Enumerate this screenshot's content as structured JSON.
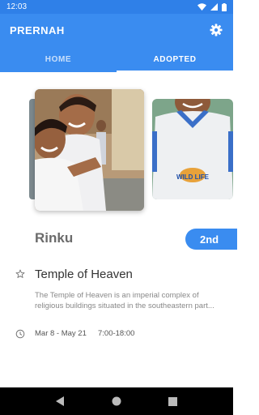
{
  "status_bar": {
    "time": "12:03",
    "icons": [
      "wifi-icon",
      "signal-icon",
      "battery-icon"
    ]
  },
  "app_bar": {
    "title": "PRERNAH",
    "settings_icon": "gear-icon"
  },
  "tabs": [
    {
      "label": "HOME",
      "active": false
    },
    {
      "label": "ADOPTED",
      "active": true
    }
  ],
  "carousel": {
    "images": [
      "children-photo",
      "child-shirt-photo"
    ],
    "shirt_logo_text": "WILD LIFE"
  },
  "profile": {
    "name": "Rinku",
    "rank_label": "2nd"
  },
  "place": {
    "icon": "star-outline-icon",
    "title": "Temple of Heaven",
    "description": "The Temple of Heaven is an imperial complex of religious buildings situated in the southeastern part...",
    "date_icon": "clock-icon",
    "dates": "Mar 8 - May 21",
    "hours": "7:00-18:00"
  },
  "nav_bar": {
    "buttons": [
      "back-icon",
      "home-icon",
      "recents-icon"
    ]
  },
  "colors": {
    "primary": "#3a8cf0",
    "status": "#2f80e8"
  }
}
